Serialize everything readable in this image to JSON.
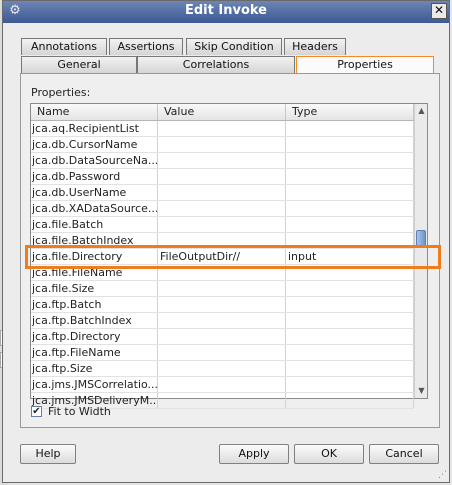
{
  "window": {
    "title": "Edit Invoke",
    "close_glyph": "✕"
  },
  "tabs": {
    "row1": [
      "Annotations",
      "Assertions",
      "Skip Condition",
      "Headers"
    ],
    "row2": [
      "General",
      "Correlations",
      "Properties"
    ]
  },
  "properties": {
    "label": "Properties:",
    "columns": [
      "Name",
      "Value",
      "Type"
    ],
    "rows": [
      {
        "name": "jca.aq.RecipientList",
        "value": "",
        "type": ""
      },
      {
        "name": "jca.db.CursorName",
        "value": "",
        "type": ""
      },
      {
        "name": "jca.db.DataSourceNa...",
        "value": "",
        "type": ""
      },
      {
        "name": "jca.db.Password",
        "value": "",
        "type": ""
      },
      {
        "name": "jca.db.UserName",
        "value": "",
        "type": ""
      },
      {
        "name": "jca.db.XADataSource...",
        "value": "",
        "type": ""
      },
      {
        "name": "jca.file.Batch",
        "value": "",
        "type": ""
      },
      {
        "name": "jca.file.BatchIndex",
        "value": "",
        "type": ""
      },
      {
        "name": "jca.file.Directory",
        "value": "FileOutputDir//",
        "type": "input"
      },
      {
        "name": "jca.file.FileName",
        "value": "",
        "type": ""
      },
      {
        "name": "jca.file.Size",
        "value": "",
        "type": ""
      },
      {
        "name": "jca.ftp.Batch",
        "value": "",
        "type": ""
      },
      {
        "name": "jca.ftp.BatchIndex",
        "value": "",
        "type": ""
      },
      {
        "name": "jca.ftp.Directory",
        "value": "",
        "type": ""
      },
      {
        "name": "jca.ftp.FileName",
        "value": "",
        "type": ""
      },
      {
        "name": "jca.ftp.Size",
        "value": "",
        "type": ""
      },
      {
        "name": "jca.jms.JMSCorrelatio...",
        "value": "",
        "type": ""
      },
      {
        "name": "jca.jms.JMSDeliveryM...",
        "value": "",
        "type": ""
      }
    ]
  },
  "fit_to_width": {
    "label": "Fit to Width",
    "checked": true,
    "check_glyph": "✔"
  },
  "buttons": {
    "help": "Help",
    "apply": "Apply",
    "ok": "OK",
    "cancel": "Cancel"
  },
  "icons": {
    "title_icon": "⚙",
    "scroll_up": "▲",
    "scroll_down": "▼",
    "resize_grip": "⋰"
  },
  "colors": {
    "highlight": "#f07c1e",
    "titlebar": "#4e6aa1",
    "active_tab_border": "#f08a2a"
  }
}
